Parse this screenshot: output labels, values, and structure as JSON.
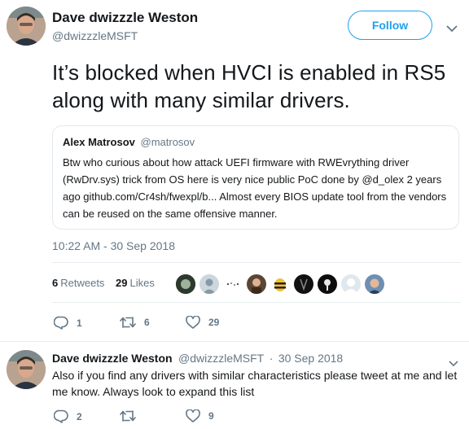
{
  "tweet": {
    "author_name": "Dave dwizzzle Weston",
    "author_handle": "@dwizzzleMSFT",
    "follow_label": "Follow",
    "text": "It’s blocked when HVCI is enabled in RS5 along with many similar drivers.",
    "quote": {
      "author_name": "Alex Matrosov",
      "author_handle": "@matrosov",
      "text": "Btw who curious about how attack UEFI firmware with RWEvrything driver (RwDrv.sys) trick from OS here is very nice public PoC done by @d_olex 2 years ago github.com/Cr4sh/fwexpl/b... Almost every BIOS update tool from the vendors can be reused on the same offensive manner."
    },
    "timestamp": "10:22 AM - 30 Sep 2018",
    "retweets_count": "6",
    "retweets_label": "Retweets",
    "likes_count": "29",
    "likes_label": "Likes",
    "actions": {
      "reply_count": "1",
      "retweet_count": "6",
      "like_count": "29"
    }
  },
  "reply": {
    "author_name": "Dave dwizzzle Weston",
    "author_handle": "@dwizzzleMSFT",
    "date": "30 Sep 2018",
    "separator": "·",
    "text": "Also if you find any drivers with similar characteristics please tweet at me and let me know.  Always look to expand this list",
    "actions": {
      "reply_count": "2",
      "retweet_count": "",
      "like_count": "9"
    }
  },
  "colors": {
    "accent": "#1da1f2",
    "secondary_text": "#657786",
    "border": "#e1e8ed"
  },
  "icons": [
    "chevron-down-icon",
    "reply-icon",
    "retweet-icon",
    "heart-icon"
  ]
}
